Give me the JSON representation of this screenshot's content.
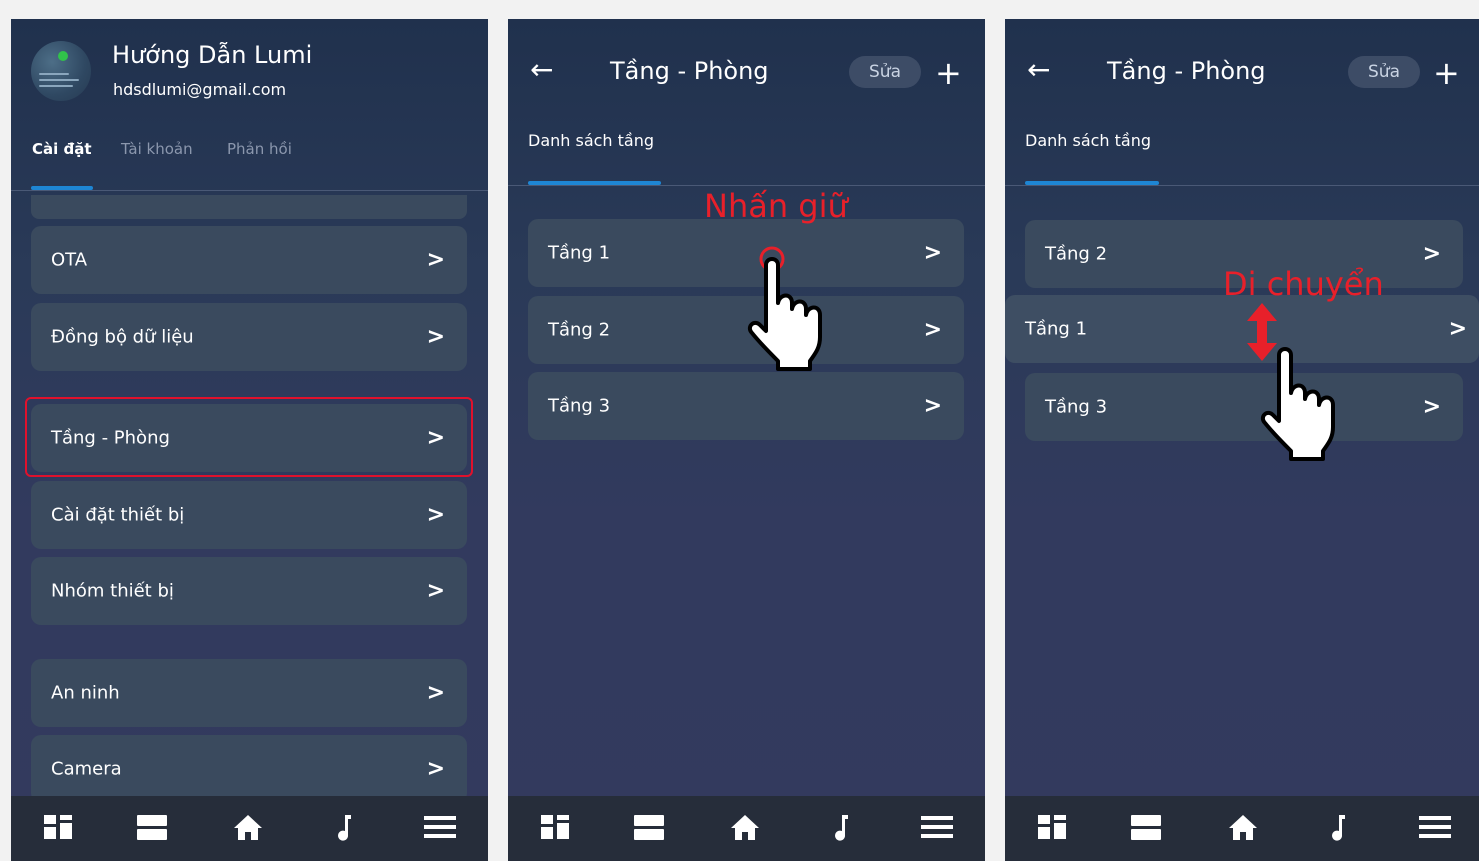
{
  "screen1": {
    "profile": {
      "name": "Hướng Dẫn Lumi",
      "email": "hdsdlumi@gmail.com"
    },
    "tabs": [
      "Cài đặt",
      "Tài khoản",
      "Phản hồi"
    ],
    "items": [
      "OTA",
      "Đồng bộ dữ liệu",
      "Tầng - Phòng",
      "Cài đặt thiết bị",
      "Nhóm thiết bị",
      "An ninh",
      "Camera"
    ],
    "highlighted_item": "Tầng - Phòng"
  },
  "screen2": {
    "title": "Tầng - Phòng",
    "edit_label": "Sửa",
    "subtitle": "Danh sách tầng",
    "floors": [
      "Tầng 1",
      "Tầng 2",
      "Tầng 3"
    ],
    "annotation": "Nhấn giữ"
  },
  "screen3": {
    "title": "Tầng - Phòng",
    "edit_label": "Sửa",
    "subtitle": "Danh sách tầng",
    "floors": [
      "Tầng 2",
      "Tầng 1",
      "Tầng 3"
    ],
    "annotation": "Di chuyển"
  },
  "icons": {
    "back": "←",
    "plus": "+",
    "chevron": ">",
    "nav": [
      "dashboard-icon",
      "list-icon",
      "home-icon",
      "music-icon",
      "menu-icon"
    ]
  },
  "colors": {
    "accent": "#1e86d4",
    "annotation": "#e8202a",
    "row_bg": "#3a4a5e",
    "nav_bg": "#262d3a"
  }
}
